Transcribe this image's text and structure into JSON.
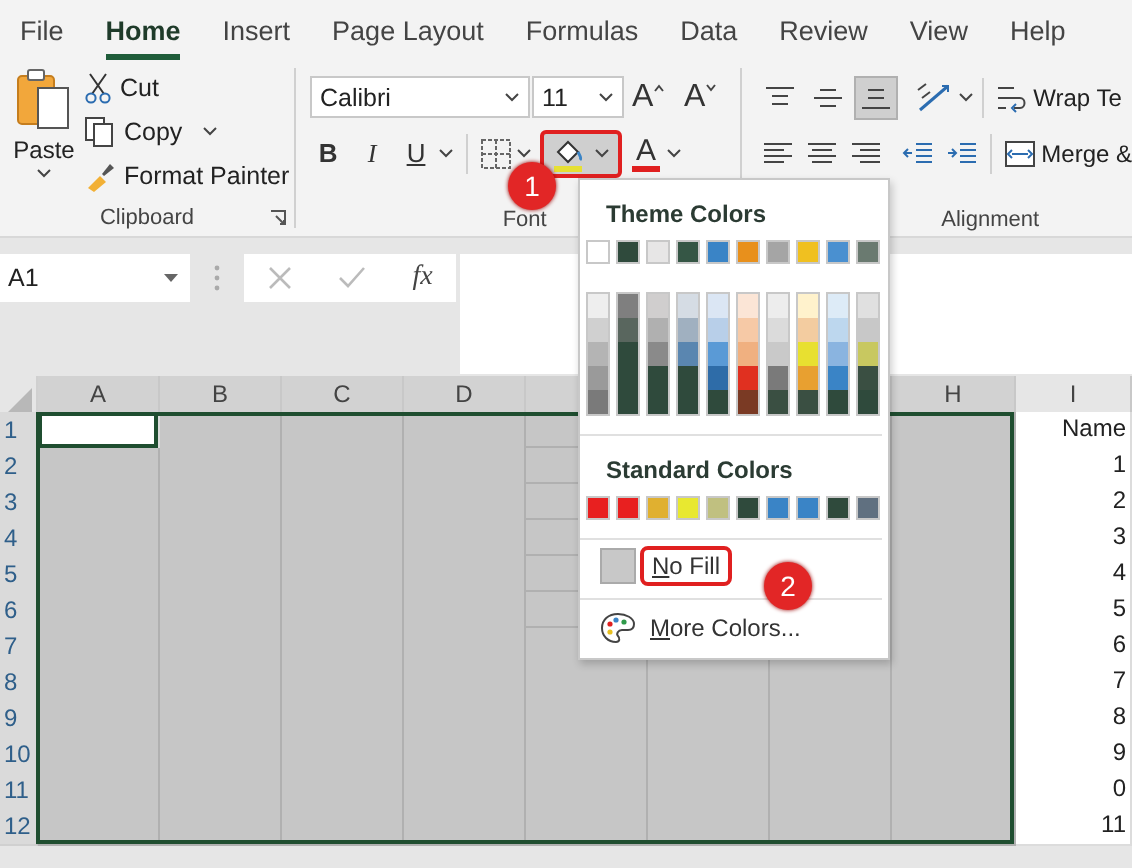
{
  "tabs": [
    {
      "label": "File",
      "selected": false
    },
    {
      "label": "Home",
      "selected": true
    },
    {
      "label": "Insert",
      "selected": false
    },
    {
      "label": "Page Layout",
      "selected": false
    },
    {
      "label": "Formulas",
      "selected": false
    },
    {
      "label": "Data",
      "selected": false
    },
    {
      "label": "Review",
      "selected": false
    },
    {
      "label": "View",
      "selected": false
    },
    {
      "label": "Help",
      "selected": false
    }
  ],
  "clipboard": {
    "paste": "Paste",
    "cut": "Cut",
    "copy": "Copy",
    "format_painter": "Format Painter",
    "label": "Clipboard"
  },
  "font": {
    "font_name": "Calibri",
    "font_size": "11",
    "grow": "A",
    "shrink": "A",
    "bold": "B",
    "italic": "I",
    "underline": "U",
    "fill_button": {
      "selected": true,
      "highlighted": true,
      "color": "#e6e034",
      "callout": "1"
    },
    "font_color": {
      "letter": "A",
      "color": "#e02020"
    },
    "label": "Font"
  },
  "alignment": {
    "vertical": [
      {
        "kind": "top",
        "selected": false
      },
      {
        "kind": "middle",
        "selected": false
      },
      {
        "kind": "bottom",
        "selected": true
      }
    ],
    "wrap_text": "Wrap Te",
    "merge": "Merge &",
    "label": "Alignment"
  },
  "formula_bar": {
    "name_box": "A1",
    "function_label": "fx"
  },
  "sheet": {
    "columns": [
      {
        "label": "A",
        "selected": true,
        "active": true
      },
      {
        "label": "B",
        "selected": true,
        "active": false
      },
      {
        "label": "C",
        "selected": true,
        "active": false
      },
      {
        "label": "D",
        "selected": true,
        "active": false
      },
      {
        "selected": true,
        "active": false
      },
      {
        "selected": true,
        "active": false
      },
      {
        "selected": true,
        "active": false
      },
      {
        "label": "H",
        "selected": true,
        "active": false
      },
      {
        "label": "I",
        "selected": false,
        "active": false,
        "cells": [
          "Name",
          "1",
          "2",
          "3",
          "4",
          "5",
          "6",
          "7",
          "8",
          "9",
          "0",
          "11"
        ]
      }
    ],
    "rows": [
      {
        "label": "1",
        "selected": true,
        "active": true
      },
      {
        "label": "2",
        "selected": true,
        "active": false
      },
      {
        "label": "3",
        "selected": true,
        "active": false
      },
      {
        "label": "4",
        "selected": true,
        "active": false
      },
      {
        "label": "5",
        "selected": true,
        "active": false
      },
      {
        "label": "6",
        "selected": true,
        "active": false
      },
      {
        "label": "7",
        "selected": true,
        "active": false
      },
      {
        "label": "8",
        "selected": true,
        "active": false
      },
      {
        "label": "9",
        "selected": true,
        "active": false
      },
      {
        "label": "10",
        "selected": true,
        "active": false
      },
      {
        "label": "11",
        "selected": true,
        "active": false
      },
      {
        "label": "12",
        "selected": true,
        "active": false
      }
    ]
  },
  "fill_menu": {
    "theme_title": "Theme Colors",
    "theme_colors": [
      {
        "color": "#ffffff",
        "shades": [
          {
            "color": "#eeeeee"
          },
          {
            "color": "#d0d0d0"
          },
          {
            "color": "#b4b4b4"
          },
          {
            "color": "#9a9a9a"
          },
          {
            "color": "#7a7a7a"
          }
        ]
      },
      {
        "color": "#2f4a3c",
        "shades": [
          {
            "color": "#7f7f7f"
          },
          {
            "color": "#59665e"
          },
          {
            "color": "#2f4a3c"
          },
          {
            "color": "#2f4a3c"
          },
          {
            "color": "#2f4a3c"
          }
        ]
      },
      {
        "color": "#e7e6e6",
        "shades": [
          {
            "color": "#d0cece"
          },
          {
            "color": "#b0b0b0"
          },
          {
            "color": "#8a8a8a"
          },
          {
            "color": "#2f4a3c"
          },
          {
            "color": "#2f4a3c"
          }
        ]
      },
      {
        "color": "#355645",
        "shades": [
          {
            "color": "#d5dce4"
          },
          {
            "color": "#a0b0c0"
          },
          {
            "color": "#5a86b0"
          },
          {
            "color": "#2f4a3c"
          },
          {
            "color": "#2f4a3c"
          }
        ]
      },
      {
        "color": "#3a84c6",
        "shades": [
          {
            "color": "#dbe6f4"
          },
          {
            "color": "#b8cfe9"
          },
          {
            "color": "#5a9ad6"
          },
          {
            "color": "#2e6ca8"
          },
          {
            "color": "#2f4a3c"
          }
        ]
      },
      {
        "color": "#e8901c",
        "shades": [
          {
            "color": "#fbe5d6"
          },
          {
            "color": "#f6c9a6"
          },
          {
            "color": "#f0b080"
          },
          {
            "color": "#e03020"
          },
          {
            "color": "#7a3a24"
          }
        ]
      },
      {
        "color": "#a5a5a5",
        "shades": [
          {
            "color": "#ededed"
          },
          {
            "color": "#dbdbdb"
          },
          {
            "color": "#c9c9c9"
          },
          {
            "color": "#7a7a7a"
          },
          {
            "color": "#3a4f42"
          }
        ]
      },
      {
        "color": "#f0c020",
        "shades": [
          {
            "color": "#fff2cc"
          },
          {
            "color": "#f3cca0"
          },
          {
            "color": "#e8e030"
          },
          {
            "color": "#e8a030"
          },
          {
            "color": "#3a4f42"
          }
        ]
      },
      {
        "color": "#4a90d0",
        "shades": [
          {
            "color": "#ddebf7"
          },
          {
            "color": "#bdd7ee"
          },
          {
            "color": "#8ab4e0"
          },
          {
            "color": "#3a84c6"
          },
          {
            "color": "#2f4a3c"
          }
        ]
      },
      {
        "color": "#6a7a70",
        "shades": [
          {
            "color": "#e0e0e0"
          },
          {
            "color": "#c8c8c8"
          },
          {
            "color": "#c8c860"
          },
          {
            "color": "#3a4f42"
          },
          {
            "color": "#2f4a3c"
          }
        ]
      }
    ],
    "standard_title": "Standard Colors",
    "standard_colors": [
      {
        "color": "#e82020"
      },
      {
        "color": "#e82020"
      },
      {
        "color": "#e0b030"
      },
      {
        "color": "#e8e830"
      },
      {
        "color": "#c0c080"
      },
      {
        "color": "#2f4a3c"
      },
      {
        "color": "#3a84c6"
      },
      {
        "color": "#3a84c6"
      },
      {
        "color": "#2f4a3c"
      },
      {
        "color": "#607080"
      }
    ],
    "no_fill": {
      "label": "No Fill",
      "highlighted": true,
      "callout": "2"
    },
    "more_colors": "More Colors..."
  }
}
